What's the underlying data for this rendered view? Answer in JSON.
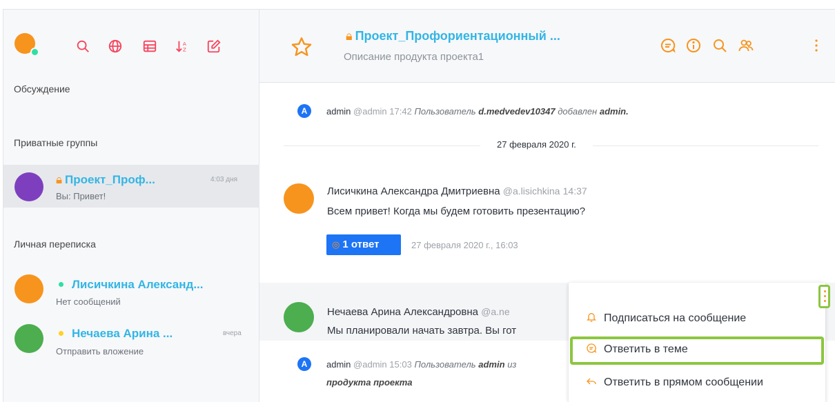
{
  "sidebar": {
    "sections": {
      "discussion": "Обсуждение",
      "private_groups": "Приватные группы",
      "direct": "Личная переписка"
    },
    "rooms": [
      {
        "name": "Проект_Проф...",
        "time": "4:03 дня",
        "preview": "Вы: Привет!",
        "avatar_color": "#7e3fbf"
      },
      {
        "name": "Лисичкина Александ...",
        "time": "",
        "preview": "Нет сообщений",
        "avatar_color": "#f7941d",
        "status_color": "#2de0a5"
      },
      {
        "name": "Нечаева Арина ...",
        "time": "вчера",
        "preview": "Отправить вложение",
        "avatar_color": "#4cae4f",
        "status_color": "#ffd21f"
      }
    ]
  },
  "header": {
    "title": "Проект_Профориентационный ...",
    "description": "Описание продукта проекта1"
  },
  "messages": {
    "system1": {
      "avatar": "A",
      "name": "admin",
      "handle": "@admin",
      "time": "17:42",
      "text_prefix": "Пользователь",
      "subject": "d.medvedev10347",
      "text_middle": "добавлен",
      "actor": "admin."
    },
    "date_divider": "27 февраля 2020 г.",
    "msg1": {
      "author": "Лисичкина Александра Дмитриевна",
      "handle": "@a.lisichkina",
      "time": "14:37",
      "text": "Всем привет! Когда мы будем готовить презентацию?",
      "reply_label": "1 ответ",
      "reply_date": "27 февраля 2020 г., 16:03"
    },
    "msg2": {
      "author": "Нечаева Арина Александровна",
      "handle": "@a.ne",
      "text": "Мы планировали начать завтра. Вы гот"
    },
    "system2": {
      "avatar": "A",
      "name": "admin",
      "handle": "@admin",
      "time": "15:03",
      "text_prefix": "Пользователь",
      "subject": "admin",
      "text_suffix": "из",
      "line2": "продукта проекта"
    }
  },
  "context_menu": {
    "items": [
      {
        "label": "Подписаться на сообщение",
        "icon": "bell-icon"
      },
      {
        "label": "Ответить в теме",
        "icon": "thread-icon"
      },
      {
        "label": "Ответить в прямом сообщении",
        "icon": "reply-arrow-icon"
      }
    ]
  },
  "colors": {
    "accent": "#f7941d",
    "link": "#33b5e5",
    "primary": "#1d74f5",
    "highlight": "#8cc63f"
  }
}
